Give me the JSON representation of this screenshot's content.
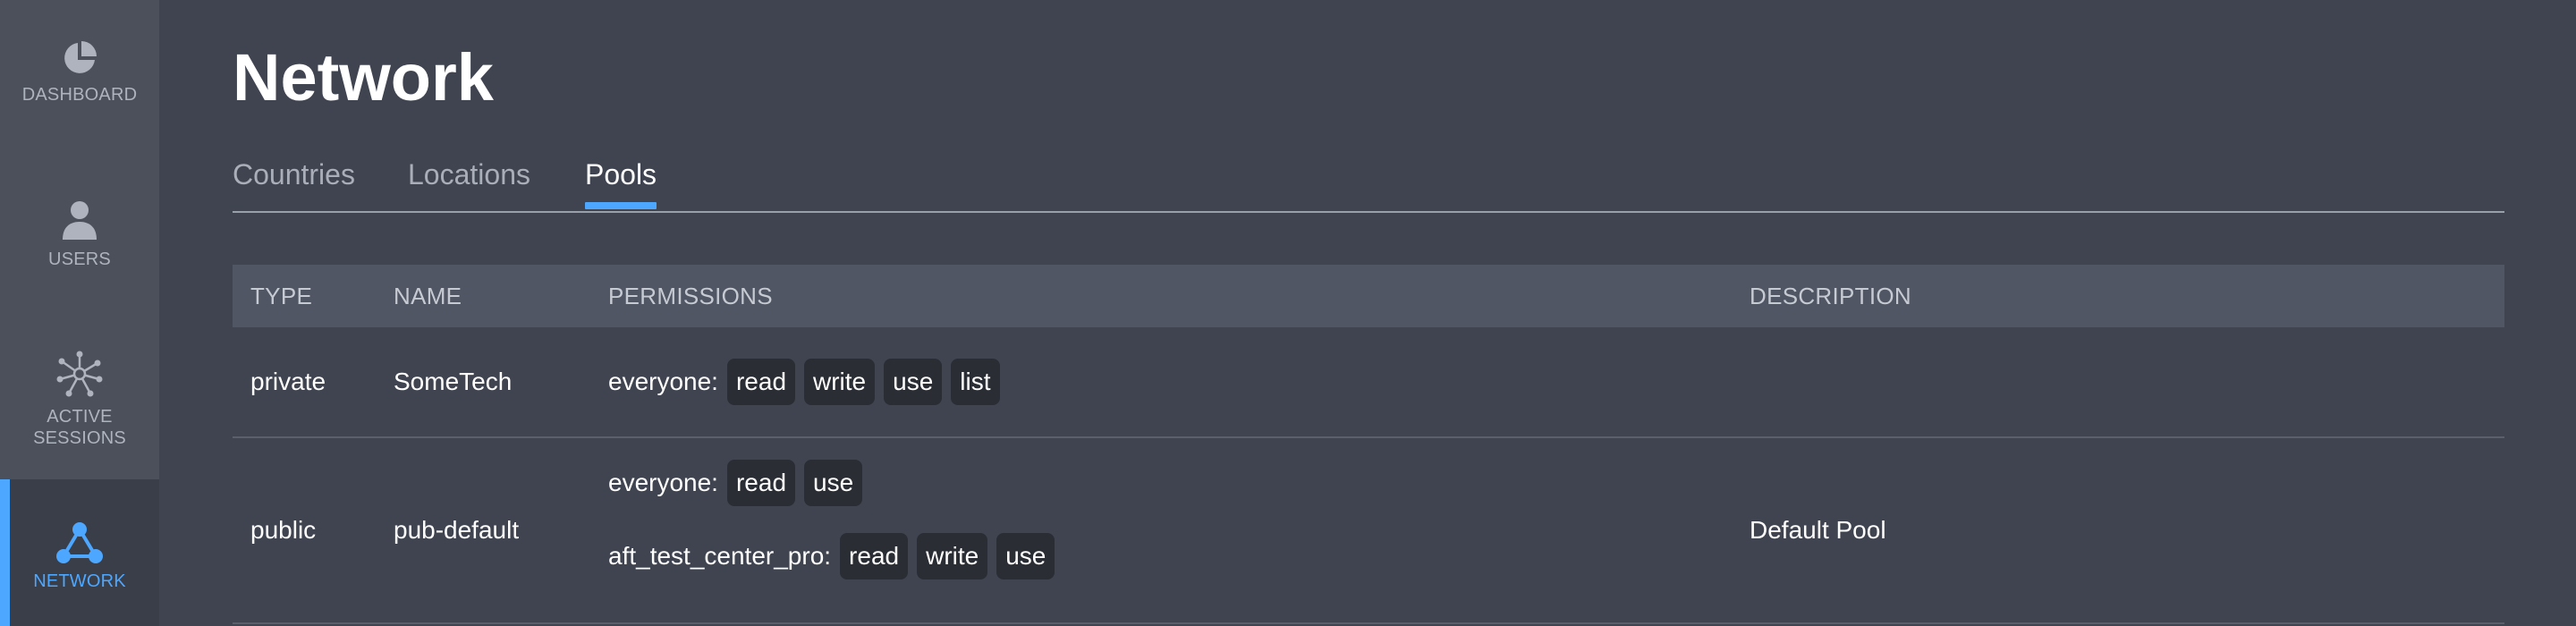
{
  "sidebar": {
    "items": [
      {
        "label": "DASHBOARD",
        "icon": "pie-chart-icon"
      },
      {
        "label": "USERS",
        "icon": "user-icon"
      },
      {
        "label": "ACTIVE\nSESSIONS",
        "icon": "network-nodes-icon"
      },
      {
        "label": "NETWORK",
        "icon": "network-triangle-icon",
        "active": true
      }
    ]
  },
  "page": {
    "title": "Network"
  },
  "tabs": [
    {
      "label": "Countries"
    },
    {
      "label": "Locations"
    },
    {
      "label": "Pools",
      "active": true
    }
  ],
  "table": {
    "headers": [
      "TYPE",
      "NAME",
      "PERMISSIONS",
      "DESCRIPTION"
    ],
    "rows": [
      {
        "type": "private",
        "name": "SomeTech",
        "permissions": [
          {
            "principal": "everyone:",
            "rights": [
              "read",
              "write",
              "use",
              "list"
            ]
          }
        ],
        "description": ""
      },
      {
        "type": "public",
        "name": "pub-default",
        "permissions": [
          {
            "principal": "everyone:",
            "rights": [
              "read",
              "use"
            ]
          },
          {
            "principal": "aft_test_center_pro:",
            "rights": [
              "read",
              "write",
              "use"
            ]
          }
        ],
        "description": "Default Pool"
      }
    ]
  },
  "colors": {
    "accent": "#4ea7ff",
    "background": "#3f4450",
    "sidebar": "#4b505b",
    "header_row": "#515664",
    "badge": "#2a2d34"
  }
}
